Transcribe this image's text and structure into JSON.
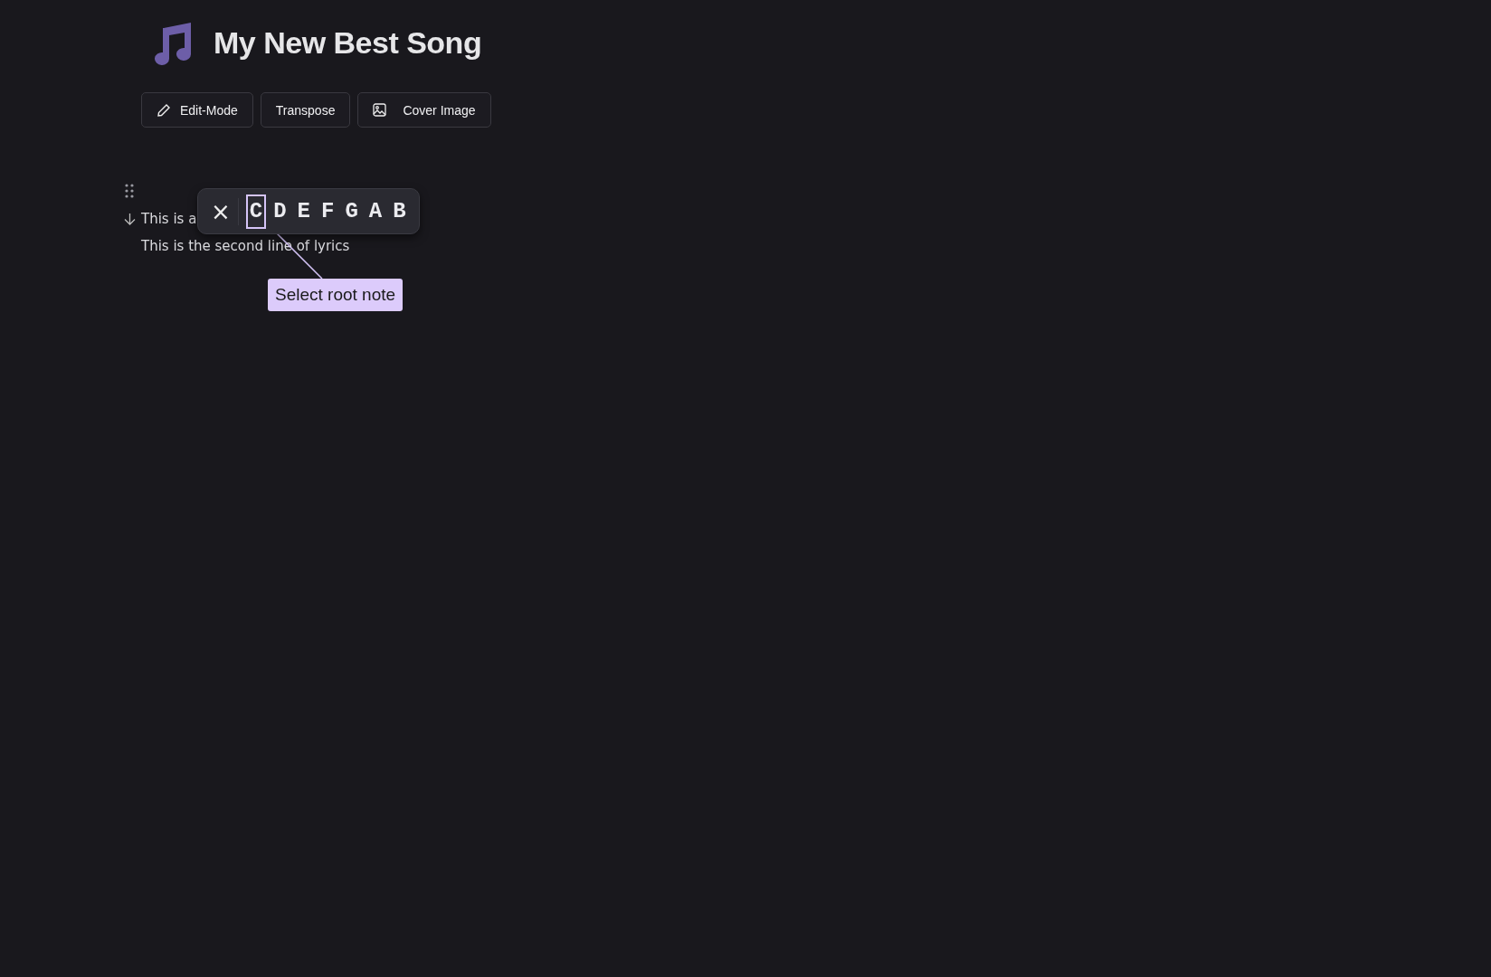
{
  "song": {
    "title": "My New Best Song"
  },
  "toolbar": [
    {
      "kind": "pencil",
      "label": "Edit-Mode"
    },
    {
      "kind": "plain",
      "label": "Transpose"
    },
    {
      "kind": "image",
      "label": "Cover Image"
    }
  ],
  "lyrics": [
    "This is a",
    "This is the second line of lyrics"
  ],
  "note_picker": {
    "close": "×",
    "notes": [
      {
        "label": "C",
        "selected": true
      },
      {
        "label": "D",
        "selected": false
      },
      {
        "label": "E",
        "selected": false
      },
      {
        "label": "F",
        "selected": false
      },
      {
        "label": "G",
        "selected": false
      },
      {
        "label": "A",
        "selected": false
      },
      {
        "label": "B",
        "selected": false
      }
    ]
  },
  "tooltip": "Select root note"
}
